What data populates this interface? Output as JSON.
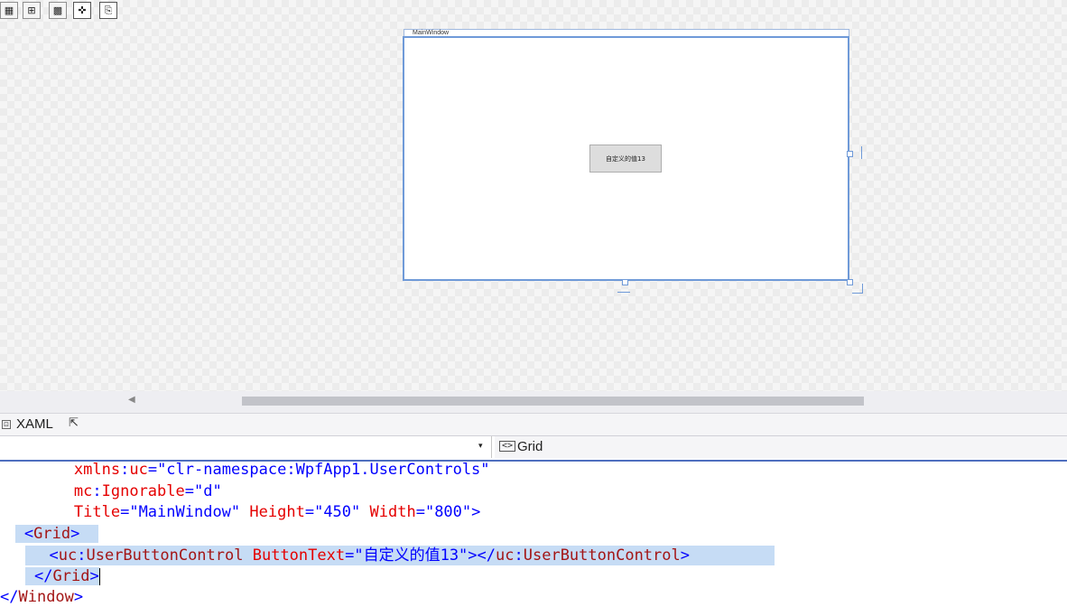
{
  "designer": {
    "window_title": "MainWindow",
    "user_control_button_text": "自定义的值13"
  },
  "toolbar": {
    "buttons": [
      {
        "name": "grid-view-icon",
        "glyph": "▦"
      },
      {
        "name": "artboard-icon",
        "glyph": "⊞"
      },
      {
        "name": "checkerboard-icon",
        "glyph": "▩"
      },
      {
        "name": "snap-icon",
        "glyph": "✜"
      },
      {
        "name": "device-icon",
        "glyph": "⎘"
      }
    ],
    "scroll_left_glyph": "◀"
  },
  "tabs": {
    "xaml_label": "XAML",
    "collapse_glyph": "⊡",
    "popout_glyph": "⇱"
  },
  "dropdowns": {
    "left_arrow": "▾",
    "right_icon": "<>",
    "right_label": "Grid"
  },
  "code": {
    "line1": {
      "indent": "        ",
      "prefix": "xmlns",
      "colon": ":",
      "attr": "uc",
      "eq": "=",
      "value": "\"clr-namespace:WpfApp1.UserControls\""
    },
    "line2": {
      "indent": "        ",
      "prefix": "mc",
      "colon": ":",
      "attr": "Ignorable",
      "eq": "=",
      "value": "\"d\""
    },
    "line3": {
      "indent": "        ",
      "attr1": "Title",
      "val1": "\"MainWindow\"",
      "attr2": "Height",
      "val2": "\"450\"",
      "attr3": "Width",
      "val3": "\"800\"",
      "end": ">"
    },
    "line4": {
      "indent": "    ",
      "open": "<",
      "elem": "Grid",
      "close": ">"
    },
    "line5": {
      "indent": "        ",
      "open": "<",
      "elem_prefix": "uc",
      "colon": ":",
      "elem": "UserButtonControl",
      "attr": "ButtonText",
      "eq": "=",
      "value": "\"自定义的值13\"",
      "mid": "></",
      "end_prefix": "uc",
      "end_colon": ":",
      "end_elem": "UserButtonControl",
      "close": ">"
    },
    "line6": {
      "indent": "    ",
      "open": "</",
      "elem": "Grid",
      "close": ">"
    },
    "line7": {
      "open": "</",
      "elem": "Window",
      "close": ">"
    }
  }
}
